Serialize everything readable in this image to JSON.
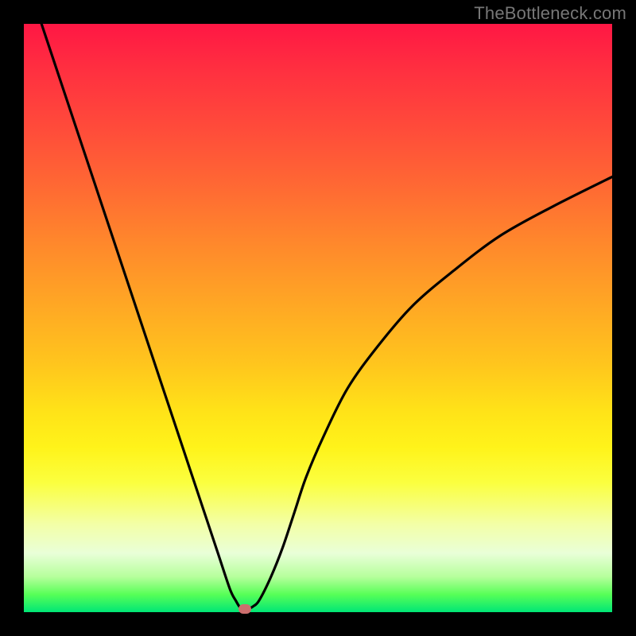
{
  "watermark": "TheBottleneck.com",
  "chart_data": {
    "type": "line",
    "title": "",
    "xlabel": "",
    "ylabel": "",
    "xlim": [
      0,
      100
    ],
    "ylim": [
      0,
      100
    ],
    "series": [
      {
        "name": "bottleneck-curve",
        "x": [
          3,
          6,
          9,
          12,
          15,
          18,
          21,
          24,
          27,
          30,
          33,
          35,
          36,
          37,
          38,
          39,
          40,
          42,
          44,
          46,
          48,
          51,
          55,
          60,
          66,
          73,
          81,
          90,
          100
        ],
        "y": [
          100,
          91,
          82,
          73,
          64,
          55,
          46,
          37,
          28,
          19,
          10,
          4,
          2,
          0.5,
          0.5,
          1,
          2,
          6,
          11,
          17,
          23,
          30,
          38,
          45,
          52,
          58,
          64,
          69,
          74
        ]
      }
    ],
    "marker": {
      "x": 37.5,
      "y": 0.5,
      "color": "#cc6e6e"
    },
    "background_gradient": {
      "top": "#ff1744",
      "mid": "#ffe318",
      "bottom": "#00e676"
    }
  }
}
